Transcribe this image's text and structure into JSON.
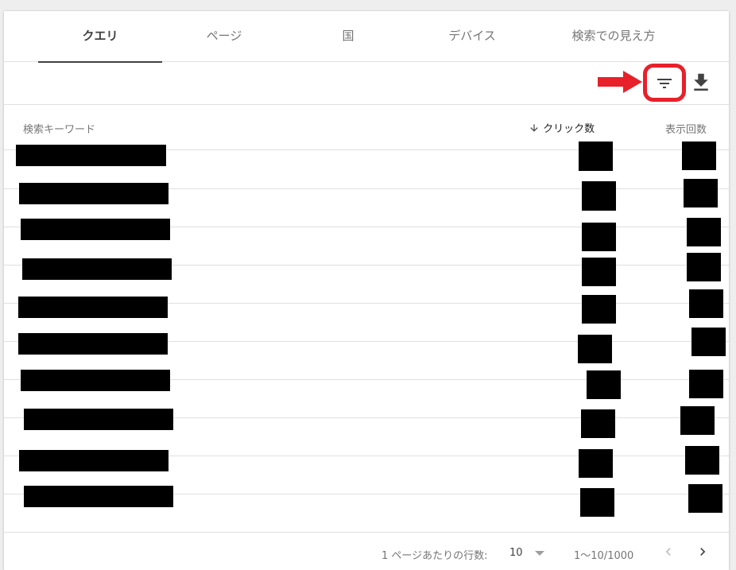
{
  "tabs": [
    {
      "label": "クエリ",
      "active": true
    },
    {
      "label": "ページ",
      "active": false
    },
    {
      "label": "国",
      "active": false
    },
    {
      "label": "デバイス",
      "active": false
    },
    {
      "label": "検索での見え方",
      "active": false
    }
  ],
  "toolbar": {
    "filter_icon": "filter-icon",
    "download_icon": "download-icon",
    "highlight_color": "#e8202a"
  },
  "table": {
    "columns": {
      "keyword": "検索キーワード",
      "clicks": "クリック数",
      "impressions": "表示回数"
    },
    "sort": "clicks-descending",
    "row_count": 10,
    "redacted": true
  },
  "footer": {
    "rows_per_page_label": "1 ページあたりの行数:",
    "rows_per_page_value": "10",
    "range": "1〜10/1000"
  }
}
